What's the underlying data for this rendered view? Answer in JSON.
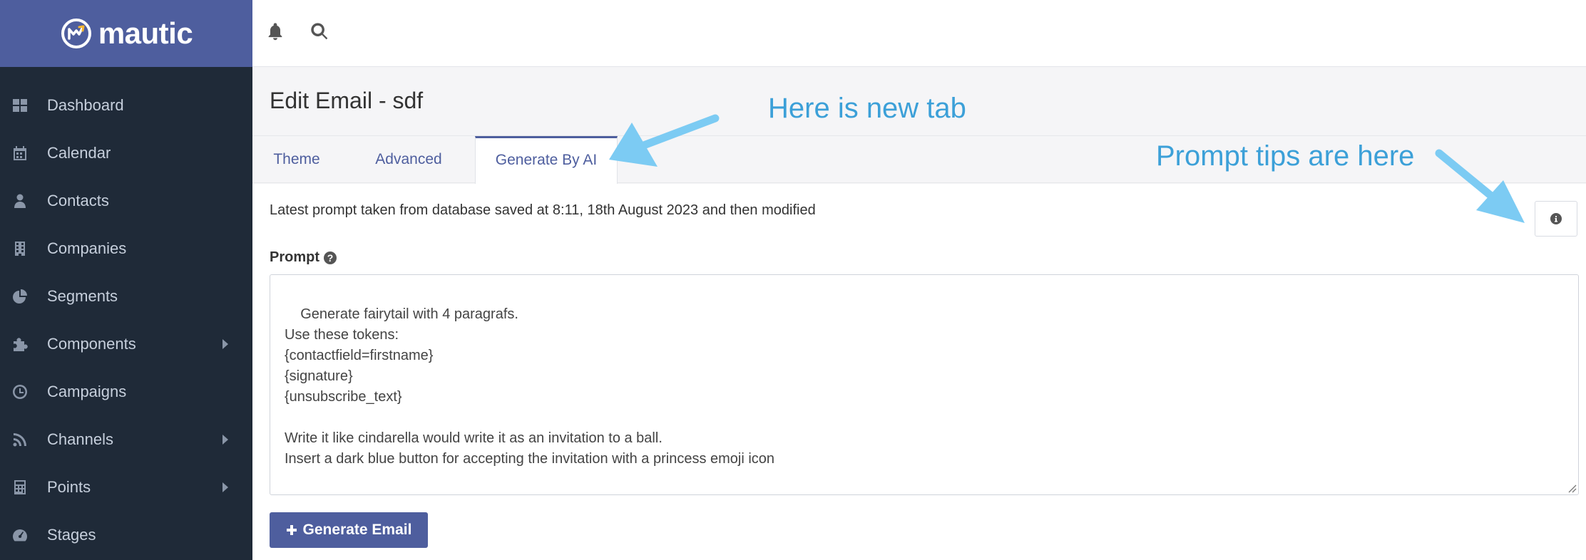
{
  "brand": {
    "name": "mautic"
  },
  "sidebar": {
    "items": [
      {
        "label": "Dashboard",
        "icon": "dashboard-icon",
        "submenu": false
      },
      {
        "label": "Calendar",
        "icon": "calendar-icon",
        "submenu": false
      },
      {
        "label": "Contacts",
        "icon": "user-icon",
        "submenu": false
      },
      {
        "label": "Companies",
        "icon": "building-icon",
        "submenu": false
      },
      {
        "label": "Segments",
        "icon": "pie-chart-icon",
        "submenu": false
      },
      {
        "label": "Components",
        "icon": "puzzle-icon",
        "submenu": true
      },
      {
        "label": "Campaigns",
        "icon": "clock-icon",
        "submenu": false
      },
      {
        "label": "Channels",
        "icon": "rss-icon",
        "submenu": true
      },
      {
        "label": "Points",
        "icon": "calculator-icon",
        "submenu": true
      },
      {
        "label": "Stages",
        "icon": "tachometer-icon",
        "submenu": false
      }
    ]
  },
  "topbar": {
    "icons": [
      "bell-icon",
      "search-icon"
    ]
  },
  "page": {
    "title": "Edit Email - sdf"
  },
  "tabs": [
    {
      "label": "Theme",
      "active": false
    },
    {
      "label": "Advanced",
      "active": false
    },
    {
      "label": "Generate By AI",
      "active": true
    }
  ],
  "content": {
    "note": "Latest prompt taken from database saved at 8:11, 18th August 2023 and then modified",
    "prompt_label": "Prompt",
    "prompt_value": "Generate fairytail with 4 paragrafs.\nUse these tokens:\n{contactfield=firstname}\n{signature}\n{unsubscribe_text}\n\nWrite it like cindarella would write it as an invitation to a ball.\nInsert a dark blue button for accepting the invitation with a princess emoji icon",
    "generate_button": "Generate Email"
  },
  "annotations": {
    "new_tab": "Here is new tab",
    "prompt_tips": "Prompt tips are here"
  },
  "colors": {
    "brand": "#4e5e9e",
    "sidebar": "#1f2a38",
    "annotation": "#3ca0d8",
    "arrow": "#7ccbf3"
  }
}
